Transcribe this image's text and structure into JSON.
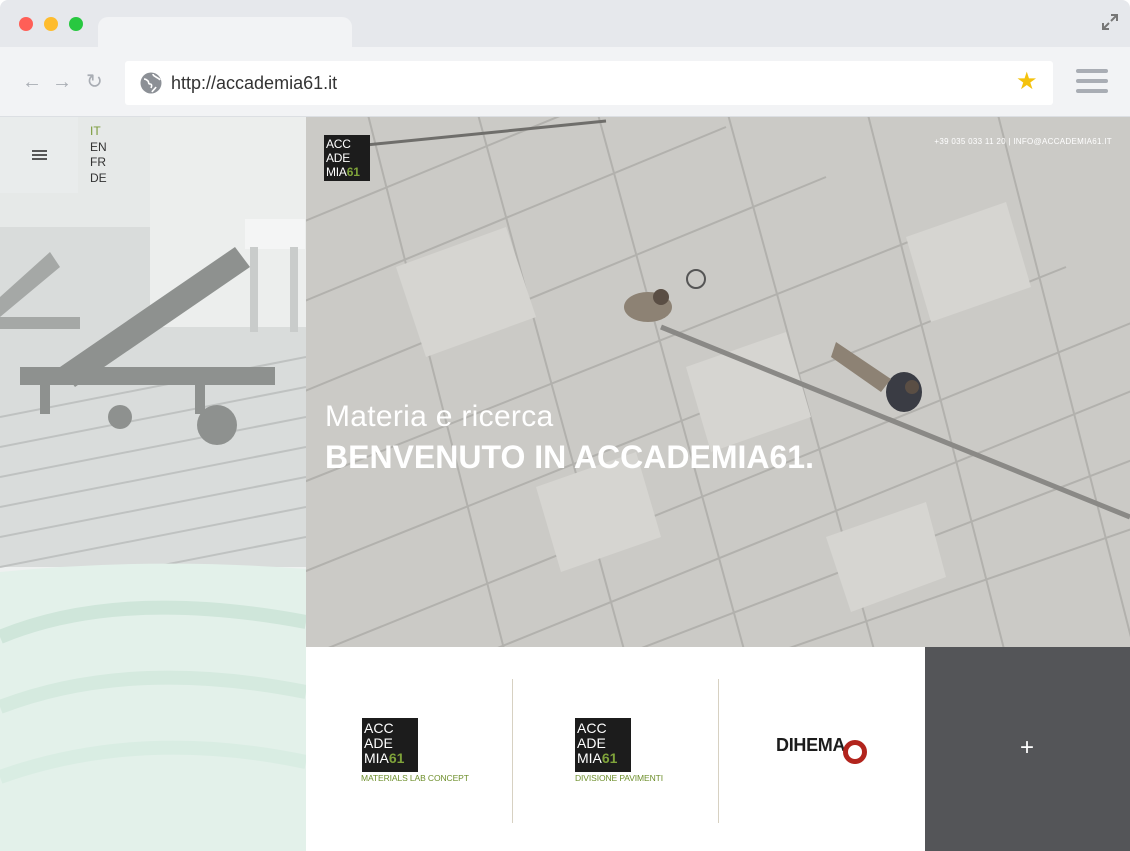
{
  "browser": {
    "url": "http://accademia61.it",
    "icons": {
      "back": "arrow-left-icon",
      "forward": "arrow-right-icon",
      "refresh": "refresh-icon",
      "globe": "globe-icon",
      "bookmark": "star-icon",
      "menu": "hamburger-icon",
      "expand": "expand-icon"
    },
    "back_glyph": "←",
    "forward_glyph": "→",
    "refresh_glyph": "↻",
    "star_glyph": "★"
  },
  "site": {
    "languages": [
      "IT",
      "EN",
      "FR",
      "DE"
    ],
    "active_language": "IT",
    "logo": {
      "line1": "ACC",
      "line2": "ADE",
      "line3": "MIA",
      "number": "61"
    },
    "contact": "+39 035 033 11 20  |  INFO@ACCADEMIA61.IT",
    "hero": {
      "subtitle": "Materia e ricerca",
      "title": "BENVENUTO IN ACCADEMIA61."
    },
    "brands": [
      {
        "caption": "MATERIALS LAB CONCEPT"
      },
      {
        "caption": "DIVISIONE PAVIMENTI"
      },
      {
        "name": "DIHEMA"
      }
    ],
    "more_glyph": "+",
    "colors": {
      "accent_green": "#7fa33a",
      "dihema_red": "#b2241d",
      "plus_box": "#545558"
    }
  }
}
